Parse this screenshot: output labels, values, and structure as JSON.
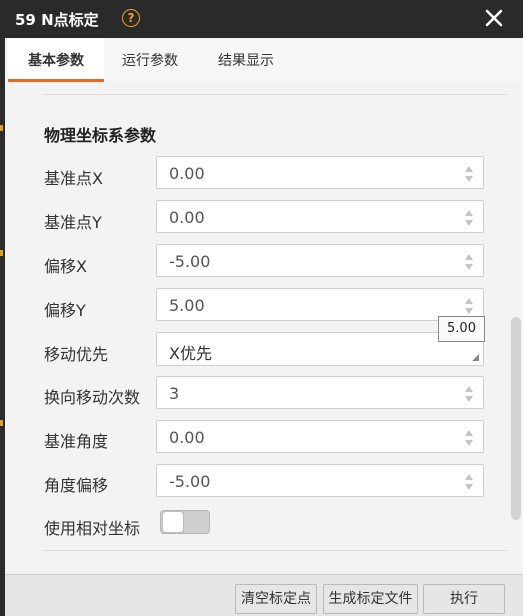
{
  "window": {
    "title": "59 N点标定",
    "help_icon": "?",
    "close_icon": "close-icon"
  },
  "tabs": [
    {
      "label": "基本参数",
      "active": true
    },
    {
      "label": "运行参数",
      "active": false
    },
    {
      "label": "结果显示",
      "active": false
    }
  ],
  "section": {
    "title": "物理坐标系参数"
  },
  "fields": {
    "base_x": {
      "label": "基准点X",
      "value": "0.00"
    },
    "base_y": {
      "label": "基准点Y",
      "value": "0.00"
    },
    "offset_x": {
      "label": "偏移X",
      "value": "-5.00"
    },
    "offset_y": {
      "label": "偏移Y",
      "value": "5.00"
    },
    "move_priority": {
      "label": "移动优先",
      "value": "X优先"
    },
    "reverse_move_count": {
      "label": "换向移动次数",
      "value": "3"
    },
    "base_angle": {
      "label": "基准角度",
      "value": "0.00"
    },
    "angle_offset": {
      "label": "角度偏移",
      "value": "-5.00"
    },
    "use_relative_coords": {
      "label": "使用相对坐标",
      "on": false
    }
  },
  "tooltip": {
    "text": "5.00"
  },
  "footer": {
    "clear_label": "清空标定点",
    "generate_label": "生成标定文件",
    "execute_label": "执行"
  },
  "colors": {
    "accent": "#e8691e",
    "titlebar": "#2a2a2a",
    "help": "#f0a020"
  }
}
